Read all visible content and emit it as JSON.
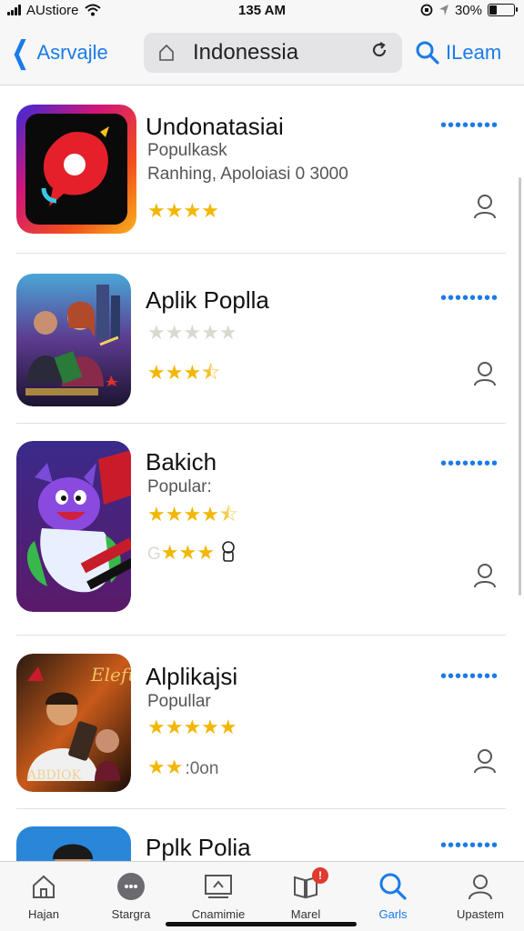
{
  "status_bar": {
    "carrier": "AUstiore",
    "time": "135 AM",
    "battery_text": "30%",
    "battery_level": 0.3
  },
  "nav": {
    "back_label": "Asrvajle",
    "search_text": "Indonessia",
    "learn_label": "ILeam"
  },
  "apps": [
    {
      "title": "Undonatasiai",
      "subtitle": "Populkask",
      "subtitle2": "Ranhing, Apoloiasi 0 3000",
      "rating": 4,
      "rating_suffix": "",
      "icon": "chat-bubble-app-icon"
    },
    {
      "title": "Aplik Poplla",
      "rating_row1_on": 0,
      "rating_row1_total": 5,
      "rating": 3.5,
      "rating_suffix": "",
      "icon": "action-movie-app-icon"
    },
    {
      "title": "Bakich",
      "subtitle": "Popular:",
      "rating": 4.5,
      "rating2_prefix": "G",
      "rating2": 3,
      "icon": "monster-game-app-icon"
    },
    {
      "title": "Alplikajsi",
      "subtitle": "Popullar",
      "rating": 5,
      "rating2": 2,
      "rating2_suffix": ":0on",
      "icon_top_text": "Elefu",
      "icon_bottom_text": "ABDIOK",
      "icon": "entertainment-app-icon"
    },
    {
      "title": "Pplk Polia",
      "icon": "profile-app-icon"
    }
  ],
  "more_dots": "••••••••",
  "tabs": [
    {
      "label": "Hajan",
      "icon": "home-icon"
    },
    {
      "label": "Stargra",
      "icon": "more-circle-icon"
    },
    {
      "label": "Cnamimie",
      "icon": "slideshow-icon"
    },
    {
      "label": "Marel",
      "icon": "book-icon",
      "badge": "!"
    },
    {
      "label": "Garls",
      "icon": "search-icon",
      "active": true
    },
    {
      "label": "Upastem",
      "icon": "person-icon"
    }
  ],
  "colors": {
    "accent": "#1a7be8",
    "star": "#f2b705",
    "badge": "#e23a2e"
  }
}
